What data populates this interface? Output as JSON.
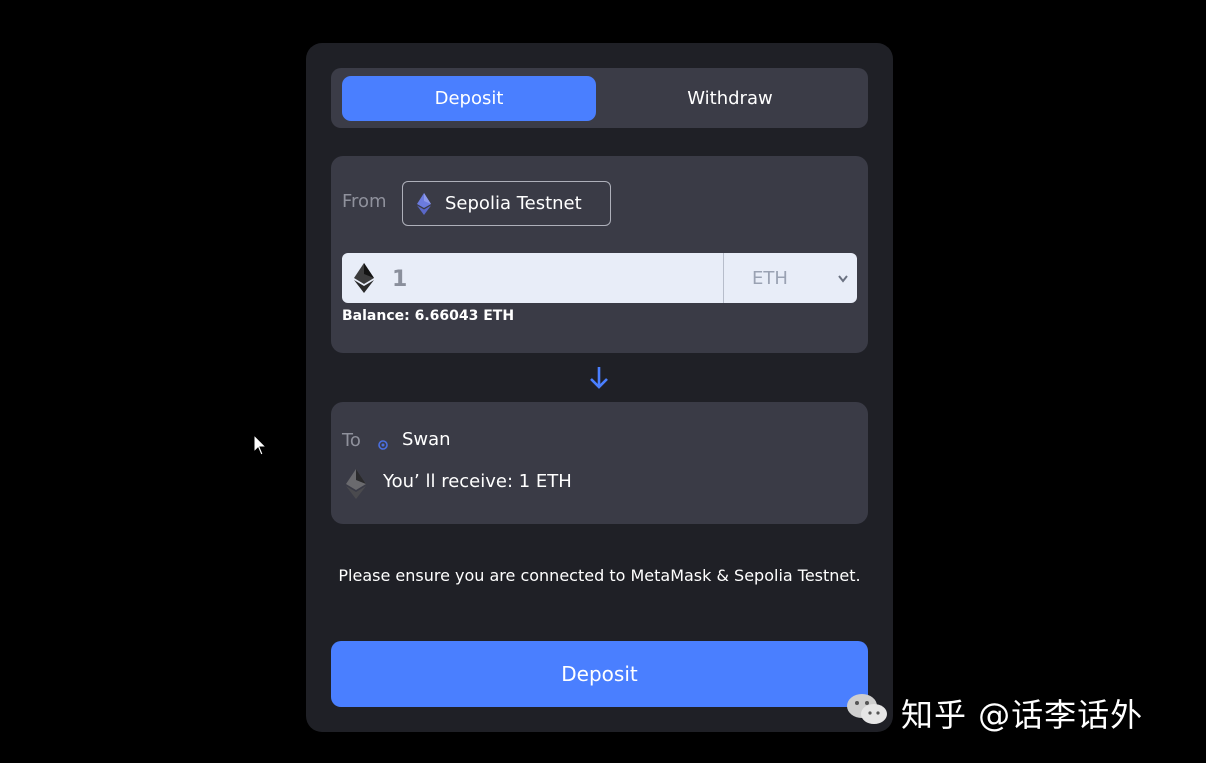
{
  "tabs": {
    "deposit": "Deposit",
    "withdraw": "Withdraw"
  },
  "from": {
    "label": "From",
    "network": "Sepolia Testnet",
    "amount": "1",
    "token": "ETH",
    "balance": "Balance: 6.66043 ETH"
  },
  "to": {
    "label": "To",
    "network": "Swan",
    "receive": "You’ ll receive: 1 ETH"
  },
  "notice": "Please ensure you are connected to MetaMask & Sepolia Testnet.",
  "deposit_button": "Deposit",
  "watermark": "知乎 @话李话外",
  "colors": {
    "accent": "#4a7fff",
    "card": "#1f2026",
    "panel": "#3a3b46"
  }
}
